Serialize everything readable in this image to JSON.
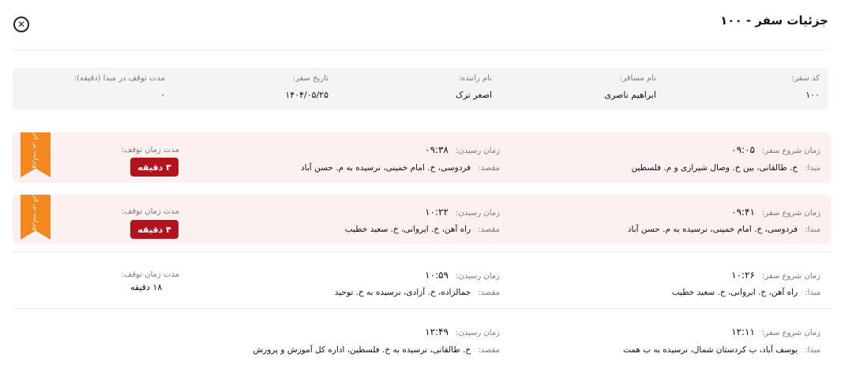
{
  "header": {
    "title": "جزئیات سفر - ۱۰۰",
    "close_icon": "close-icon"
  },
  "summary": {
    "code_label": "کد سفر:",
    "code_value": "۱۰۰",
    "passenger_label": "نام مسافر:",
    "passenger_value": "ابراهیم ناصری",
    "driver_label": "نام راننده:",
    "driver_value": "اصغر ترک",
    "date_label": "تاریخ سفر:",
    "date_value": "۱۴۰۴/۰۵/۲۵",
    "wait_label": "مدت توقف در مبدا (دقیقه):",
    "wait_value": "۰"
  },
  "segments": [
    {
      "start_label": "زمان شروع سفر:",
      "start_time": "۰۹:۰۵",
      "origin_label": "مبدا:",
      "origin": "خ. طالقانی، بین خ. وصال شیرازی و م. فلسطین",
      "arrive_label": "زمان رسیدن:",
      "arrive_time": "۰۹:۳۸",
      "dest_label": "مقصد:",
      "dest": "فردوسی، خ. امام خمینی، نرسیده به م. حسن آباد",
      "stop_label": "مدت زمان توقف:",
      "stop_value": "۳ دقیقه",
      "ribbon": "ویزایت بی اثر"
    },
    {
      "start_label": "زمان شروع سفر:",
      "start_time": "۰۹:۴۱",
      "origin_label": "مبدا:",
      "origin": "فردوسی، خ. امام خمینی، نرسیده به م. حسن آباد",
      "arrive_label": "زمان رسیدن:",
      "arrive_time": "۱۰:۲۲",
      "dest_label": "مقصد:",
      "dest": "راه آهن، خ. ایروانی، خ. سعید خطیب",
      "stop_label": "مدت زمان توقف:",
      "stop_value": "۴ دقیقه",
      "ribbon": "ویزایت بی اثر"
    },
    {
      "start_label": "زمان شروع سفر:",
      "start_time": "۱۰:۲۶",
      "origin_label": "مبدا:",
      "origin": "راه آهن، خ. ایروانی، خ. سعید خطیب",
      "arrive_label": "زمان رسیدن:",
      "arrive_time": "۱۰:۵۹",
      "dest_label": "مقصد:",
      "dest": "جمالزاده، خ. آزادی، نرسیده به خ. توحید",
      "stop_label": "مدت زمان توقف:",
      "stop_value": "۱۸ دقیقه"
    },
    {
      "start_label": "زمان شروع سفر:",
      "start_time": "۱۲:۱۱",
      "origin_label": "مبدا:",
      "origin": "یوسف آباد، ب کردستان شمال، نرسیده به ب همت",
      "arrive_label": "زمان رسیدن:",
      "arrive_time": "۱۲:۴۹",
      "dest_label": "مقصد:",
      "dest": "خ. طالقانی، نرسیده به خ. فلسطین، اداره کل آموزش و پرورش"
    }
  ],
  "colors": {
    "alert_bg": "#fdf0f0",
    "badge": "#b3141b",
    "ribbon": "#f5871f",
    "summary_bg": "#f3f4f5"
  }
}
